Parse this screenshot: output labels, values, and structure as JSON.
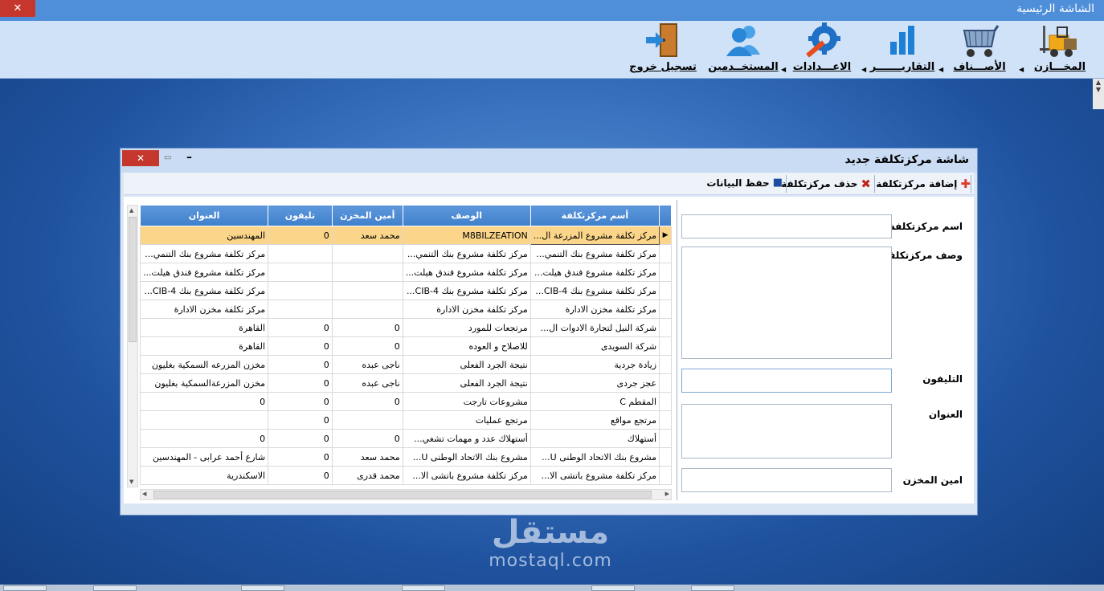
{
  "window": {
    "title": "الشاشة الرئيسية",
    "close_label": "✕"
  },
  "main_toolbar": [
    {
      "label": "المخـــازن",
      "icon": "forklift-icon"
    },
    {
      "label": "الأصـــناف",
      "icon": "cart-icon"
    },
    {
      "label": "التقاريـــــــر",
      "icon": "bar-chart-icon"
    },
    {
      "label": "الاعـــدادات",
      "icon": "gear-wrench-icon"
    },
    {
      "label": "المستخــدمين",
      "icon": "users-icon"
    },
    {
      "label": "تسجيل خروج",
      "icon": "exit-door-icon"
    }
  ],
  "dialog": {
    "title": "شاشة مركزتكلفة جديد",
    "close_label": "✕",
    "max_label": "▭",
    "min_label": "–",
    "toolbar": {
      "add": "إضافة مركزتكلفة",
      "delete": "حذف مركزتكلفة",
      "save": "حفظ البيانات"
    },
    "form": {
      "name_label": "اسم مركزتكلفة",
      "desc_label": "وصف مركزتكلفة",
      "phone_label": "التليفون",
      "address_label": "العنوان",
      "keeper_label": "امين المخزن"
    },
    "grid": {
      "columns": [
        "أسم مركزتكلفة",
        "الوصف",
        "أمين المخزن",
        "تليفون",
        "العنوان"
      ],
      "rows": [
        [
          "مركز تكلفة مشروع المزرعة ال...",
          "M8BILZEATION",
          "محمد سعد",
          "0",
          "المهندسين"
        ],
        [
          "مركز تكلفة مشروع بنك التنمي...",
          "مركز تكلفة مشروع بنك التنمي...",
          "",
          "",
          "مركز تكلفة مشروع بنك التنمي..."
        ],
        [
          "مركز تكلفة مشروع فندق هيلت...",
          "مركز تكلفة مشروع فندق هيلت...",
          "",
          "",
          "مركز تكلفة مشروع فندق هيلت..."
        ],
        [
          "مركز تكلفة مشروع بنك CIB-4...",
          "مركز تكلفة مشروع بنك CIB-4...",
          "",
          "",
          "مركز تكلفة مشروع بنك CIB-4..."
        ],
        [
          "مركز تكلفة مخزن الادارة",
          "مركز تكلفة مخزن الادارة",
          "",
          "",
          "مركز تكلفة مخزن الادارة"
        ],
        [
          "شركة النيل لتجارة الادوات ال...",
          "مرتجعات للمورد",
          "0",
          "0",
          "القاهرة"
        ],
        [
          "شركة السويدى",
          "للاصلاح و العوده",
          "0",
          "0",
          "القاهرة"
        ],
        [
          "زيادة جردية",
          "نتيجة الجرد الفعلى",
          "ناجى عبده",
          "0",
          "مخزن المزرعه السمكية بغليون"
        ],
        [
          "عجز جردى",
          "نتيجة الجرد الفعلى",
          "ناجى عبده",
          "0",
          "مخزن المزرعةالسمكية بغليون"
        ],
        [
          "المقطم C",
          "مشروعات تارجت",
          "0",
          "0",
          "0"
        ],
        [
          "مرتجع مواقع",
          "مرتجع عمليات",
          "",
          "0",
          ""
        ],
        [
          "أستهلاك",
          "أستهلاك عدد و مهمات تشغي...",
          "0",
          "0",
          "0"
        ],
        [
          "مشروع بنك الاتحاد الوطنى U...",
          "مشروع بنك الاتحاد الوطنى U...",
          "محمد سعد",
          "0",
          "شارع أحمد عرابى - المهندسين"
        ],
        [
          "مركز تكلفة مشروع باتشى الا...",
          "مركز تكلفة مشروع باتشى الا...",
          "محمد قدرى",
          "0",
          "الاسكندرية"
        ]
      ]
    }
  },
  "watermark": {
    "arabic": "مستقل",
    "latin": "mostaql.com"
  }
}
